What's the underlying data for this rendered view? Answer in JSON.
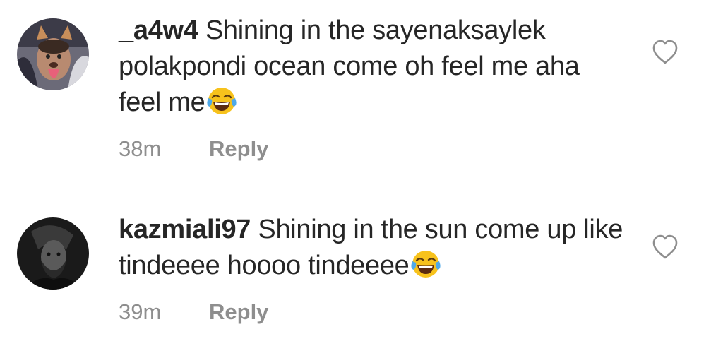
{
  "comments": [
    {
      "username": "_a4w4",
      "text": " Shining in the sayenaksaylek polakpondi ocean come oh feel me aha feel me",
      "emoji": "face-with-tears-of-joy",
      "time": "38m",
      "reply_label": "Reply"
    },
    {
      "username": "kazmiali97",
      "text": " Shining in the sun come up like tindeeee hoooo tindeeee",
      "emoji": "face-with-tears-of-joy",
      "time": "39m",
      "reply_label": "Reply"
    }
  ],
  "colors": {
    "text": "#262626",
    "meta": "#8e8e8e",
    "heart": "#8e8e8e"
  },
  "icons": {
    "like": "heart-outline-icon",
    "emoji": "tears-of-joy-emoji-icon"
  }
}
